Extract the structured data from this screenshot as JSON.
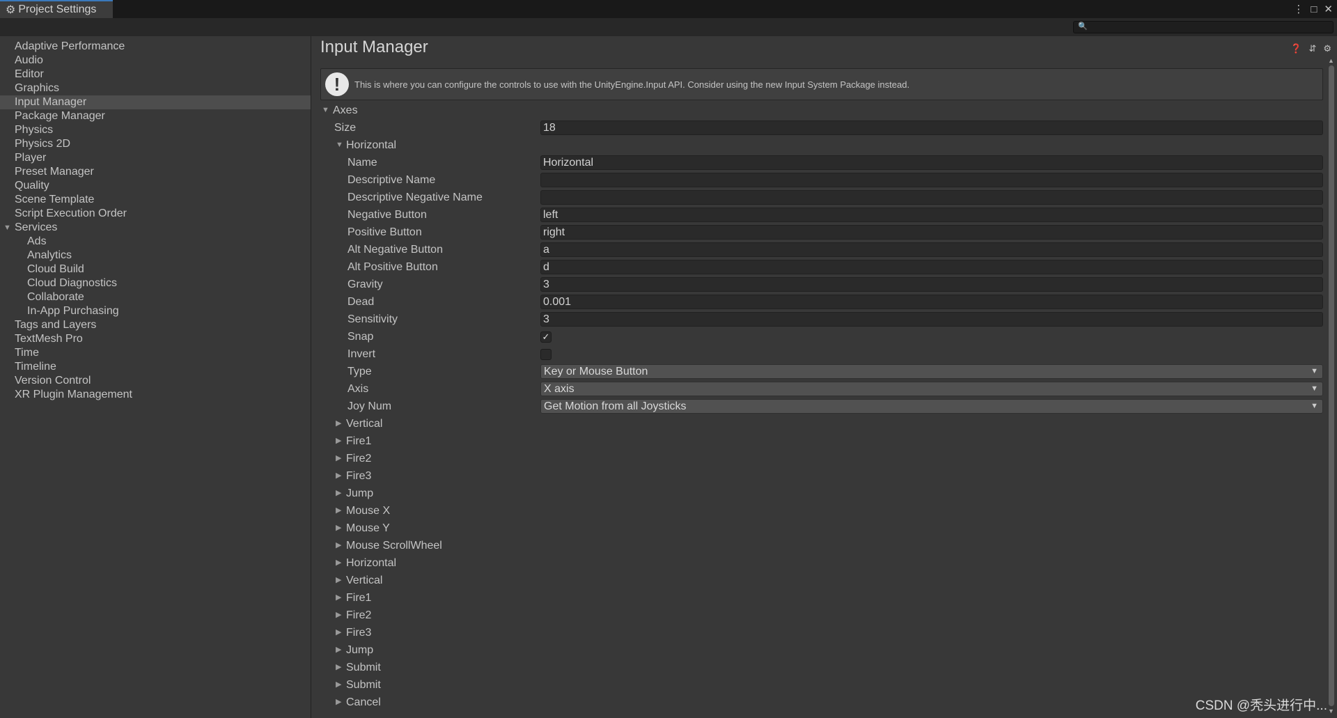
{
  "window": {
    "tab_title": "Project Settings",
    "controls": [
      "⋮",
      "□",
      "✕"
    ]
  },
  "sidebar": {
    "items": [
      {
        "label": "Adaptive Performance",
        "indent": 0
      },
      {
        "label": "Audio",
        "indent": 0
      },
      {
        "label": "Editor",
        "indent": 0
      },
      {
        "label": "Graphics",
        "indent": 0
      },
      {
        "label": "Input Manager",
        "indent": 0,
        "selected": true
      },
      {
        "label": "Package Manager",
        "indent": 0
      },
      {
        "label": "Physics",
        "indent": 0
      },
      {
        "label": "Physics 2D",
        "indent": 0
      },
      {
        "label": "Player",
        "indent": 0
      },
      {
        "label": "Preset Manager",
        "indent": 0
      },
      {
        "label": "Quality",
        "indent": 0
      },
      {
        "label": "Scene Template",
        "indent": 0
      },
      {
        "label": "Script Execution Order",
        "indent": 0
      },
      {
        "label": "Services",
        "indent": 0,
        "expanded": true
      },
      {
        "label": "Ads",
        "indent": 1
      },
      {
        "label": "Analytics",
        "indent": 1
      },
      {
        "label": "Cloud Build",
        "indent": 1
      },
      {
        "label": "Cloud Diagnostics",
        "indent": 1
      },
      {
        "label": "Collaborate",
        "indent": 1
      },
      {
        "label": "In-App Purchasing",
        "indent": 1
      },
      {
        "label": "Tags and Layers",
        "indent": 0
      },
      {
        "label": "TextMesh Pro",
        "indent": 0
      },
      {
        "label": "Time",
        "indent": 0
      },
      {
        "label": "Timeline",
        "indent": 0
      },
      {
        "label": "Version Control",
        "indent": 0
      },
      {
        "label": "XR Plugin Management",
        "indent": 0
      }
    ]
  },
  "main": {
    "title": "Input Manager",
    "help_message": "This is where you can configure the controls to use with the UnityEngine.Input API. Consider using the new Input System Package instead.",
    "axes_label": "Axes",
    "size_label": "Size",
    "size_value": "18",
    "expanded_axis": {
      "label": "Horizontal",
      "fields": [
        {
          "label": "Name",
          "kind": "text",
          "value": "Horizontal"
        },
        {
          "label": "Descriptive Name",
          "kind": "text",
          "value": ""
        },
        {
          "label": "Descriptive Negative Name",
          "kind": "text",
          "value": ""
        },
        {
          "label": "Negative Button",
          "kind": "text",
          "value": "left"
        },
        {
          "label": "Positive Button",
          "kind": "text",
          "value": "right"
        },
        {
          "label": "Alt Negative Button",
          "kind": "text",
          "value": "a"
        },
        {
          "label": "Alt Positive Button",
          "kind": "text",
          "value": "d"
        },
        {
          "label": "Gravity",
          "kind": "text",
          "value": "3"
        },
        {
          "label": "Dead",
          "kind": "text",
          "value": "0.001"
        },
        {
          "label": "Sensitivity",
          "kind": "text",
          "value": "3"
        },
        {
          "label": "Snap",
          "kind": "checkbox",
          "checked": true
        },
        {
          "label": "Invert",
          "kind": "checkbox",
          "checked": false
        },
        {
          "label": "Type",
          "kind": "dropdown",
          "value": "Key or Mouse Button"
        },
        {
          "label": "Axis",
          "kind": "dropdown",
          "value": "X axis"
        },
        {
          "label": "Joy Num",
          "kind": "dropdown",
          "value": "Get Motion from all Joysticks"
        }
      ]
    },
    "collapsed_axes": [
      "Vertical",
      "Fire1",
      "Fire2",
      "Fire3",
      "Jump",
      "Mouse X",
      "Mouse Y",
      "Mouse ScrollWheel",
      "Horizontal",
      "Vertical",
      "Fire1",
      "Fire2",
      "Fire3",
      "Jump",
      "Submit",
      "Submit",
      "Cancel"
    ]
  },
  "watermark": "CSDN @秃头进行中..."
}
